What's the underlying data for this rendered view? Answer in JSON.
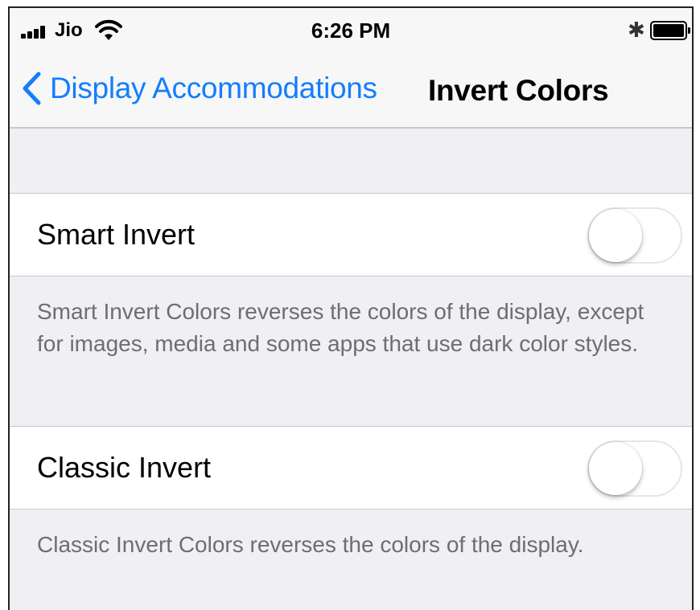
{
  "status_bar": {
    "carrier": "Jio",
    "time": "6:26 PM",
    "bluetooth_icon": "bluetooth-icon",
    "battery_icon": "battery-icon",
    "wifi_icon": "wifi-icon",
    "signal_icon": "signal-icon"
  },
  "nav": {
    "back_label": "Display Accommodations",
    "title": "Invert Colors",
    "accent": "#147efb"
  },
  "settings": [
    {
      "label": "Smart Invert",
      "enabled": false,
      "footer": "Smart Invert Colors reverses the colors of the display, except for images, media and some apps that use dark color styles."
    },
    {
      "label": "Classic Invert",
      "enabled": false,
      "footer": "Classic Invert Colors reverses the colors of the display."
    }
  ]
}
